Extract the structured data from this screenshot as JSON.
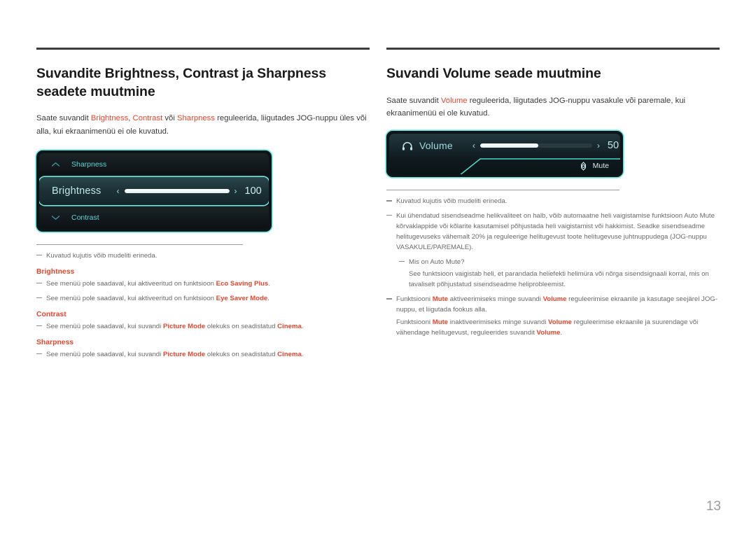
{
  "page": {
    "number": "13"
  },
  "left": {
    "title": "Suvandite Brightness, Contrast ja Sharpness seadete muutmine",
    "intro_1": "Saate suvandit ",
    "intro_hl1": "Brightness",
    "intro_2": ", ",
    "intro_hl2": "Contrast",
    "intro_3": " või ",
    "intro_hl3": "Sharpness",
    "intro_4": " reguleerida, liigutades JOG-nuppu üles või alla, kui ekraanimenüü ei ole kuvatud.",
    "osd": {
      "row_top_label": "Sharpness",
      "row_top_icon": "chevron-up-icon",
      "row_selected_label": "Brightness",
      "row_selected_value": "100",
      "row_selected_fill_percent": 100,
      "arrow_left": "‹",
      "arrow_right": "›",
      "row_bottom_label": "Contrast",
      "row_bottom_icon": "chevron-down-icon"
    },
    "notes": {
      "model_note": "Kuvatud kujutis võib mudeliti erineda.",
      "brightness_head": "Brightness",
      "brightness_n1_a": "See menüü pole saadaval, kui aktiveeritud on funktsioon ",
      "brightness_n1_b": "Eco Saving Plus",
      "brightness_n1_c": ".",
      "brightness_n2_a": "See menüü pole saadaval, kui aktiveeritud on funktsioon ",
      "brightness_n2_b": "Eye Saver Mode",
      "brightness_n2_c": ".",
      "contrast_head": "Contrast",
      "contrast_n1_a": "See menüü pole saadaval, kui suvandi ",
      "contrast_n1_b": "Picture Mode",
      "contrast_n1_c": " olekuks on seadistatud ",
      "contrast_n1_d": "Cinema",
      "contrast_n1_e": ".",
      "sharpness_head": "Sharpness",
      "sharpness_n1_a": "See menüü pole saadaval, kui suvandi ",
      "sharpness_n1_b": "Picture Mode",
      "sharpness_n1_c": " olekuks on seadistatud ",
      "sharpness_n1_d": "Cinema",
      "sharpness_n1_e": "."
    }
  },
  "right": {
    "title": "Suvandi Volume seade muutmine",
    "intro_1": "Saate suvandit ",
    "intro_hl1": "Volume",
    "intro_2": " reguleerida, liigutades JOG-nuppu vasakule või paremale, kui ekraanimenüü ei ole kuvatud.",
    "osd": {
      "label": "Volume",
      "icon": "headphones-icon",
      "value": "50",
      "fill_percent": 52,
      "arrow_left": "‹",
      "arrow_right": "›",
      "mute_label": "Mute",
      "mute_icon": "jog-button-icon"
    },
    "notes": {
      "model_note": "Kuvatud kujutis võib mudeliti erineda.",
      "automute_note": "Kui ühendatud sisendseadme helikvaliteet on halb, võib automaatne heli vaigistamise funktsioon Auto Mute kõrvaklappide või kõlarite kasutamisel põhjustada heli vaigistamist või hakkimist. Seadke sisendseadme helitugevuseks vähemalt 20% ja reguleerige helitugevust toote helitugevuse juhtnuppudega (JOG-nuppu VASAKULE/PAREMALE).",
      "what_is_automute": "Mis on Auto Mute?",
      "automute_answer": "See funktsioon vaigistab heli, et parandada heliefekti helimüra või nõrga sisendsignaali korral, mis on tavaliselt põhjustatud sisendseadme heliprobleemist.",
      "mute_on_a": "Funktsiooni ",
      "mute_on_b": "Mute",
      "mute_on_c": " aktiveerimiseks minge suvandi ",
      "mute_on_d": "Volume",
      "mute_on_e": " reguleerimise ekraanile ja kasutage seejärel JOG-nuppu, et liigutada fookus alla.",
      "mute_off_a": "Funktsiooni ",
      "mute_off_b": "Mute",
      "mute_off_c": " inaktiveerimiseks minge suvandi ",
      "mute_off_d": "Volume",
      "mute_off_e": " reguleerimise ekraanile ja suurendage või vähendage helitugevust, reguleerides suvandit ",
      "mute_off_f": "Volume",
      "mute_off_g": "."
    }
  },
  "colors": {
    "accent_red": "#e8452c",
    "osd_cyan": "#62e4e0",
    "osd_text": "#5fd4d8",
    "page_number_grey": "#9b9b9b"
  }
}
